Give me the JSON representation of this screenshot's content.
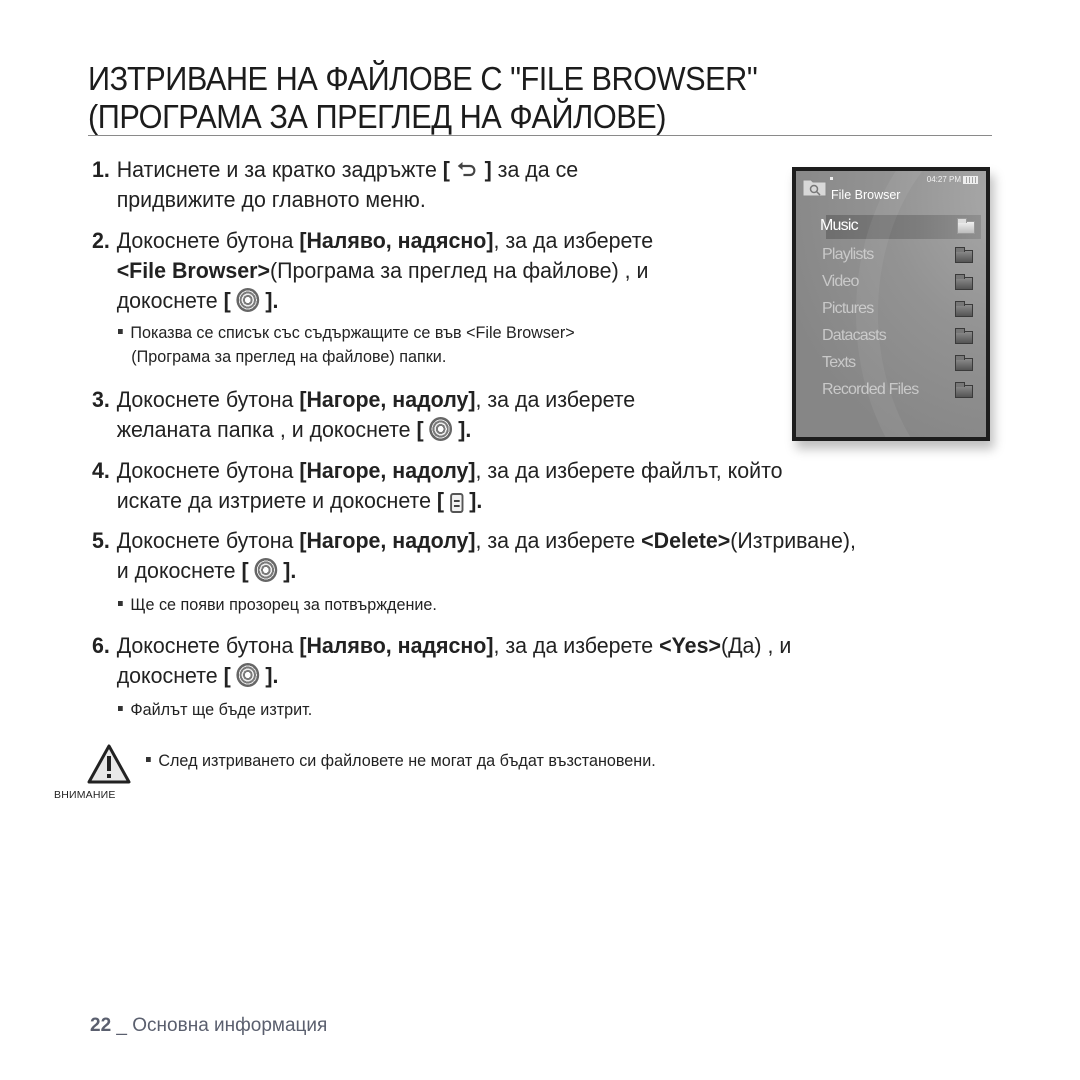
{
  "title": {
    "line1": "ИЗТРИВАНЕ НА ФАЙЛОВЕ С \"FILE BROWSER\"",
    "line2": "(ПРОГРАМА ЗА ПРЕГЛЕД НА ФАЙЛОВЕ)"
  },
  "steps": [
    {
      "num": "1.",
      "parts": [
        "Натиснете и за кратко задръжте ",
        "[",
        "back-icon",
        "]",
        " за да се",
        "придвижите до главното меню."
      ]
    },
    {
      "num": "2.",
      "a": "Докоснете бутона ",
      "b": "[Наляво, надясно]",
      "c": ", за да изберете",
      "d": "<File Browser>",
      "e": "(Програма за преглед на файлове) , и",
      "f": "докоснете ",
      "g": "[",
      "h": "]."
    },
    {
      "num": "3.",
      "a": "Докоснете бутона ",
      "b": "[Нагоре, надолу]",
      "c": ", за да изберете",
      "d": "желаната папка , и докоснете ",
      "g": "[",
      "h": "]."
    },
    {
      "num": "4.",
      "a": "Докоснете бутона ",
      "b": "[Нагоре, надолу]",
      "c": ", за да изберете файлът, който",
      "d": "искате да изтриете и докоснете  ",
      "g": "[",
      "h": "]."
    },
    {
      "num": "5.",
      "a": "Докоснете бутона ",
      "b": "[Нагоре, надолу]",
      "c": ", за да изберете ",
      "d": "<Delete>",
      "e": "(Изтриване),",
      "f": "и докоснете ",
      "g": "[",
      "h": "]."
    },
    {
      "num": "6.",
      "a": " Докоснете бутона ",
      "b": "[Наляво, надясно]",
      "c": ", за да изберете ",
      "d": "<Yes>",
      "e": "(Да) , и",
      "f": "докоснете ",
      "g": "[",
      "h": "]."
    }
  ],
  "step1": {
    "line1": "Натиснете и за кратко задръжте ",
    "bracket_open": "[",
    "bracket_close": "]",
    "line1_end": " за да се",
    "line2": "придвижите до главното меню."
  },
  "bullets": {
    "step2_line1": "Показва се списък със съдържащите се във <File Browser>",
    "step2_line2": "(Програма за преглед на файлове) папки.",
    "step5": "Ще се появи прозорец за потвърждение.",
    "step6": "Файлът ще бъде изтрит."
  },
  "warning": {
    "label": "ВНИМАНИЕ",
    "text": "След изтриването си файловете не могат да бъдат възстановени."
  },
  "device": {
    "time": "04:27 PM",
    "header": "File Browser",
    "items": [
      {
        "label": "Music",
        "selected": true
      },
      {
        "label": "Playlists",
        "selected": false
      },
      {
        "label": "Video",
        "selected": false
      },
      {
        "label": "Pictures",
        "selected": false
      },
      {
        "label": "Datacasts",
        "selected": false
      },
      {
        "label": "Texts",
        "selected": false
      },
      {
        "label": "Recorded Files",
        "selected": false
      }
    ]
  },
  "footer": {
    "page": "22",
    "sep": " _ ",
    "section": "Основна информация"
  }
}
